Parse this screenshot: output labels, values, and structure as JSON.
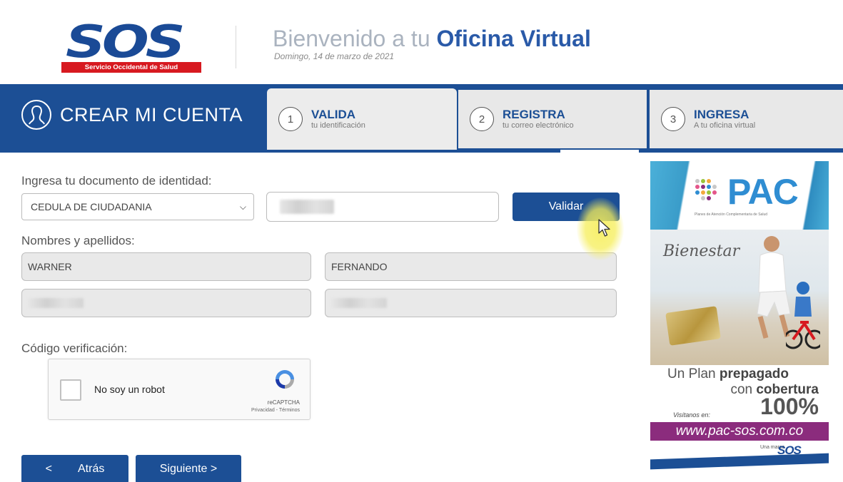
{
  "header": {
    "logo_text": "SOS",
    "logo_subtitle": "Servicio Occidental de Salud",
    "welcome_prefix": "Bienvenido a tu ",
    "welcome_strong": "Oficina Virtual",
    "date": "Domingo, 14 de marzo de 2021"
  },
  "steps_bar": {
    "title": "CREAR MI CUENTA",
    "steps": [
      {
        "number": "1",
        "title": "VALIDA",
        "subtitle": "tu identificación",
        "active": true
      },
      {
        "number": "2",
        "title": "REGISTRA",
        "subtitle": "tu correo electrónico",
        "active": false
      },
      {
        "number": "3",
        "title": "INGRESA",
        "subtitle": "A tu oficina virtual",
        "active": false
      }
    ]
  },
  "form": {
    "document_label": "Ingresa tu documento de identidad:",
    "document_type_selected": "CEDULA DE CIUDADANIA",
    "document_number_value": "",
    "validate_button": "Validar",
    "names_label": "Nombres y apellidos:",
    "first_name": "WARNER",
    "second_name": "FERNANDO",
    "first_surname": "",
    "second_surname": "",
    "verification_label": "Código verificación:"
  },
  "recaptcha": {
    "label": "No soy un robot",
    "brand": "reCAPTCHA",
    "links": "Privacidad - Términos"
  },
  "footer_buttons": {
    "back_arrow": "<",
    "back": "Atrás",
    "next": "Siguiente >"
  },
  "ad": {
    "brand": "PAC",
    "brand_subtitle": "Planes de Atención Complementaria de Salud",
    "tagline_script": "Bienestar",
    "plan_line1_prefix": "Un Plan ",
    "plan_line1_strong": "prepagado",
    "plan_line2_prefix": "con ",
    "plan_line2_strong": "cobertura",
    "percent": "100%",
    "visit_label": "Visítanos en:",
    "url": "www.pac-sos.com.co",
    "brand_mark_prefix": "Una marca",
    "brand_mark": "SOS"
  },
  "colors": {
    "primary_blue": "#1c4f95",
    "logo_red": "#d71920",
    "ad_purple": "#8b2c7d",
    "pac_blue": "#2f8dd2",
    "cursor_highlight": "#f6ee5a"
  },
  "icons": [
    "user-circle-icon",
    "chevron-down-icon",
    "recaptcha-icon",
    "mouse-cursor-icon"
  ]
}
